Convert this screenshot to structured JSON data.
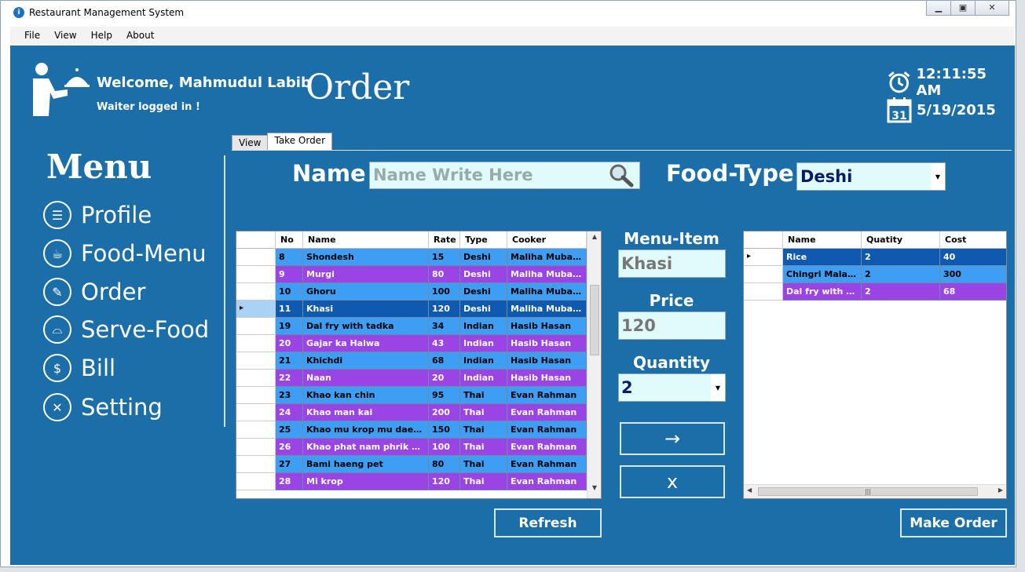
{
  "window": {
    "title": "Restaurant Management System"
  },
  "menubar": [
    "File",
    "View",
    "Help",
    "About"
  ],
  "header": {
    "welcome": "Welcome, Mahmudul Labib",
    "role": "Waiter logged in !",
    "page_title": "Order",
    "time": "12:11:55 AM",
    "date": "5/19/2015",
    "calendar_day": "31"
  },
  "sidebar": {
    "title": "Menu",
    "items": [
      {
        "label": "Profile",
        "icon": "profile-icon"
      },
      {
        "label": "Food-Menu",
        "icon": "food-menu-icon"
      },
      {
        "label": "Order",
        "icon": "order-icon"
      },
      {
        "label": "Serve-Food",
        "icon": "serve-food-icon"
      },
      {
        "label": "Bill",
        "icon": "bill-icon"
      },
      {
        "label": "Setting",
        "icon": "setting-icon"
      }
    ]
  },
  "tabs": [
    "View",
    "Take Order"
  ],
  "filter": {
    "name_label": "Name",
    "name_placeholder": "Name Write Here",
    "food_type_label": "Food-Type",
    "food_type_value": "Deshi"
  },
  "menu_grid": {
    "columns": [
      "No",
      "Name",
      "Rate",
      "Type",
      "Cooker"
    ],
    "rows": [
      {
        "no": "8",
        "name": "Shondesh",
        "rate": "15",
        "type": "Deshi",
        "cooker": "Maliha Mubass...",
        "style": "blue"
      },
      {
        "no": "9",
        "name": "Murgi",
        "rate": "80",
        "type": "Deshi",
        "cooker": "Maliha Mubass...",
        "style": "purple"
      },
      {
        "no": "10",
        "name": "Ghoru",
        "rate": "100",
        "type": "Deshi",
        "cooker": "Maliha Mubass...",
        "style": "blue"
      },
      {
        "no": "11",
        "name": "Khasi",
        "rate": "120",
        "type": "Deshi",
        "cooker": "Maliha Mubass...",
        "style": "sel"
      },
      {
        "no": "19",
        "name": "Dal fry with tadka",
        "rate": "34",
        "type": "Indian",
        "cooker": "Hasib Hasan",
        "style": "blue"
      },
      {
        "no": "20",
        "name": "Gajar ka Halwa",
        "rate": "43",
        "type": "Indian",
        "cooker": "Hasib Hasan",
        "style": "purple"
      },
      {
        "no": "21",
        "name": "Khichdi",
        "rate": "68",
        "type": "Indian",
        "cooker": "Hasib Hasan",
        "style": "blue"
      },
      {
        "no": "22",
        "name": "Naan",
        "rate": "20",
        "type": "Indian",
        "cooker": "Hasib Hasan",
        "style": "purple"
      },
      {
        "no": "23",
        "name": "Khao kan chin",
        "rate": "95",
        "type": "Thai",
        "cooker": "Evan Rahman",
        "style": "blue"
      },
      {
        "no": "24",
        "name": "Khao man kai",
        "rate": "200",
        "type": "Thai",
        "cooker": "Evan Rahman",
        "style": "purple"
      },
      {
        "no": "25",
        "name": "Khao mu krop mu daeng",
        "rate": "150",
        "type": "Thai",
        "cooker": "Evan Rahman",
        "style": "blue"
      },
      {
        "no": "26",
        "name": "Khao phat nam phrik narok",
        "rate": "100",
        "type": "Thai",
        "cooker": "Evan Rahman",
        "style": "purple"
      },
      {
        "no": "27",
        "name": "Bami haeng pet",
        "rate": "80",
        "type": "Thai",
        "cooker": "Evan Rahman",
        "style": "blue"
      },
      {
        "no": "28",
        "name": "Mi krop",
        "rate": "120",
        "type": "Thai",
        "cooker": "Evan Rahman",
        "style": "purple"
      }
    ]
  },
  "order_form": {
    "menu_item_label": "Menu-Item",
    "menu_item_value": "Khasi",
    "price_label": "Price",
    "price_value": "120",
    "quantity_label": "Quantity",
    "quantity_value": "2",
    "add_button": "→",
    "remove_button": "x"
  },
  "order_grid": {
    "columns": [
      "Name",
      "Quatity",
      "Cost"
    ],
    "rows": [
      {
        "name": "Rice",
        "qty": "2",
        "cost": "40",
        "style": "sel"
      },
      {
        "name": "Chingri Malai c...",
        "qty": "2",
        "cost": "300",
        "style": "blue"
      },
      {
        "name": "Dal fry with ta...",
        "qty": "2",
        "cost": "68",
        "style": "purple"
      }
    ]
  },
  "buttons": {
    "refresh": "Refresh",
    "make_order": "Make Order"
  },
  "colors": {
    "panel": "#1b6ea7",
    "row_blue": "#3d9ef3",
    "row_purple": "#9a44e6",
    "row_selected": "#0f5ab0",
    "field_bg": "#dffcfb"
  }
}
